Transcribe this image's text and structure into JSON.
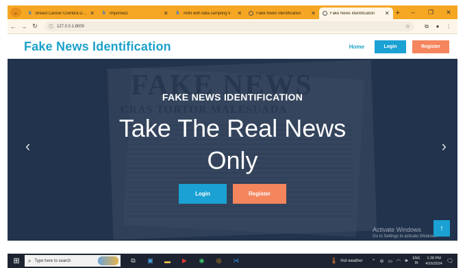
{
  "browser": {
    "tabs": [
      {
        "title": "Breast Cancer Coimbra Data",
        "favicon": "k-icon",
        "active": false
      },
      {
        "title": "Imported2",
        "favicon": "k-icon",
        "active": false
      },
      {
        "title": "ANN with data sampling ti",
        "favicon": "k-icon",
        "active": false
      },
      {
        "title": "Fake News Identification",
        "favicon": "globe-icon",
        "active": false
      },
      {
        "title": "Fake News Identification",
        "favicon": "globe-icon",
        "active": true
      }
    ],
    "new_tab": "+",
    "url": "127.0.0.1:8000",
    "accent_color": "#f5a623"
  },
  "site": {
    "logo": "Fake News Identification",
    "nav": {
      "home": "Home",
      "login": "Login",
      "register": "Register"
    }
  },
  "hero": {
    "kicker": "FAKE NEWS IDENTIFICATION",
    "title": "Take The Real News Only",
    "login": "Login",
    "register": "Register",
    "prev_arrow": "‹",
    "next_arrow": "›",
    "background_text": "FAKE NEWS",
    "background_subtext": "CRAS TORTOR MALESUADA"
  },
  "watermark": {
    "line1": "Activate Windows",
    "line2": "Go to Settings to activate Windows."
  },
  "taskbar": {
    "search_placeholder": "Type here to search",
    "weather": "Hot weather",
    "lang1": "ENG",
    "lang2": "IN",
    "time": "1:28 PM",
    "date": "4/16/2024"
  },
  "colors": {
    "brand": "#1ba1c9",
    "login_button": "#1ba1d3",
    "register_button": "#f4855c",
    "hero_background": "#2a3e5a"
  }
}
